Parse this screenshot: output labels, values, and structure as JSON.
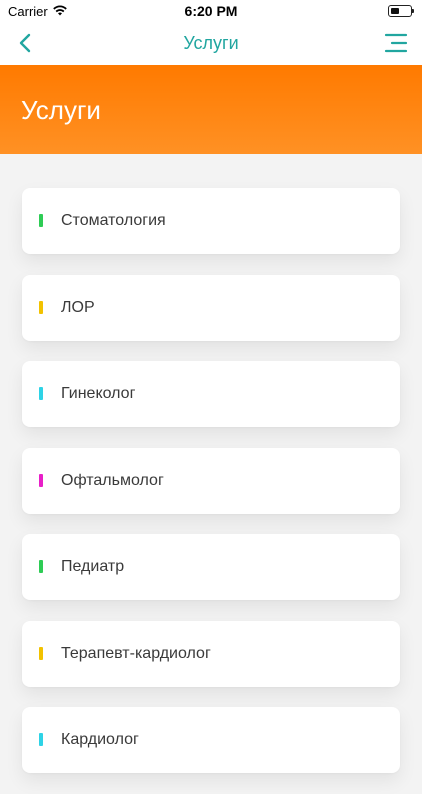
{
  "status_bar": {
    "carrier": "Carrier",
    "time": "6:20 PM",
    "icons": [
      "wifi-icon",
      "battery-icon"
    ]
  },
  "nav": {
    "title": "Услуги",
    "back_icon": "chevron-left-icon",
    "menu_icon": "hamburger-menu-icon",
    "accent_color": "#21a6a0"
  },
  "hero": {
    "title": "Услуги",
    "gradient": [
      "#ff7a00",
      "#ff9124"
    ]
  },
  "services": [
    {
      "label": "Стоматология",
      "color": "#2ecc55"
    },
    {
      "label": "ЛОР",
      "color": "#f2c200"
    },
    {
      "label": "Гинеколог",
      "color": "#2ed3e6"
    },
    {
      "label": "Офтальмолог",
      "color": "#e81fc8"
    },
    {
      "label": "Педиатр",
      "color": "#2ecc55"
    },
    {
      "label": "Терапевт-кардиолог",
      "color": "#f2c200"
    },
    {
      "label": "Кардиолог",
      "color": "#2ed3e6"
    }
  ]
}
